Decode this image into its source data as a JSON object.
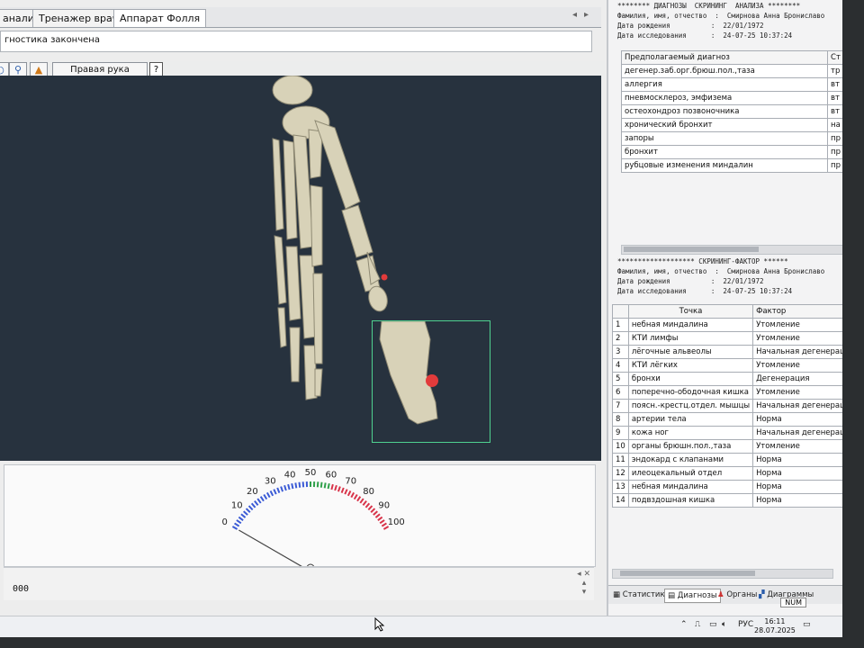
{
  "left_app": {
    "tabs": [
      {
        "label": "анализ"
      },
      {
        "label": "Тренажер врача"
      },
      {
        "label": "Аппарат Фолля"
      }
    ],
    "status_text": "гностика закончена",
    "toolbar": {
      "hand_button": "Правая рука",
      "help_button": "?"
    },
    "gauge": {
      "ticks": [
        "0",
        "10",
        "20",
        "30",
        "40",
        "50",
        "60",
        "70",
        "80",
        "90",
        "100"
      ],
      "needle_value": 0
    },
    "counter": "000"
  },
  "right_app": {
    "diag_header": {
      "title_line": "******** ДИАГНОЗЫ  СКРИНИНГ  АНАЛИЗА ********",
      "fio_label": "Фамилия, имя, отчество",
      "fio_value": "Смирнова Анна Брониславо",
      "dob_label": "Дата рождения",
      "dob_value": "22/01/1972",
      "exam_label": "Дата исследования",
      "exam_value": "24-07-25 10:37:24"
    },
    "diag_table": {
      "header": "Предполагаемый диагноз",
      "header2": "Ст",
      "rows": [
        {
          "name": "дегенер.заб.орг.брюш.пол.,таза",
          "code": "тр"
        },
        {
          "name": "аллергия",
          "code": "вт"
        },
        {
          "name": "пневмосклероз, эмфизема",
          "code": "вт"
        },
        {
          "name": "остеохондроз позвоночника",
          "code": "вт"
        },
        {
          "name": "хронический бронхит",
          "code": "на"
        },
        {
          "name": "запоры",
          "code": "пр"
        },
        {
          "name": "бронхит",
          "code": "пр"
        },
        {
          "name": "рубцовые изменения миндалин",
          "code": "пр"
        }
      ]
    },
    "factor_header": {
      "title_line": "******************* СКРИНИНГ-ФАКТОР ******",
      "fio_label": "Фамилия, имя, отчество",
      "fio_value": "Смирнова Анна Брониславо",
      "dob_label": "Дата рождения",
      "dob_value": "22/01/1972",
      "exam_label": "Дата исследования",
      "exam_value": "24-07-25 10:37:24"
    },
    "factor_table": {
      "col_point": "Точка",
      "col_factor": "Фактор",
      "rows": [
        {
          "n": "1",
          "point": "небная миндалина",
          "factor": "Утомление"
        },
        {
          "n": "2",
          "point": "КТИ лимфы",
          "factor": "Утомление"
        },
        {
          "n": "3",
          "point": "лёгочные альвеолы",
          "factor": "Начальная дегенерац"
        },
        {
          "n": "4",
          "point": "КТИ лёгких",
          "factor": "Утомление"
        },
        {
          "n": "5",
          "point": "бронхи",
          "factor": "Дегенерация"
        },
        {
          "n": "6",
          "point": "поперечно-ободочная кишка",
          "factor": "Утомление"
        },
        {
          "n": "7",
          "point": "поясн.-крестц.отдел. мышцы",
          "factor": "Начальная дегенерац"
        },
        {
          "n": "8",
          "point": "артерии тела",
          "factor": "Норма"
        },
        {
          "n": "9",
          "point": "кожа ног",
          "factor": "Начальная дегенерац"
        },
        {
          "n": "10",
          "point": "органы брюшн.пол.,таза",
          "factor": "Утомление"
        },
        {
          "n": "11",
          "point": "эндокард с клапанами",
          "factor": "Норма"
        },
        {
          "n": "12",
          "point": "илеоцекальный отдел",
          "factor": "Норма"
        },
        {
          "n": "13",
          "point": "небная миндалина",
          "factor": "Норма"
        },
        {
          "n": "14",
          "point": "подвздошная кишка",
          "factor": "Норма"
        }
      ]
    },
    "bottom_tabs": [
      {
        "label": "Статистика"
      },
      {
        "label": "Диагнозы"
      },
      {
        "label": "Органы"
      },
      {
        "label": "Диаграммы"
      }
    ],
    "num_indicator": "NUM"
  },
  "taskbar": {
    "lang": "РУС",
    "time": "16:11",
    "date": "28.07.2025"
  }
}
